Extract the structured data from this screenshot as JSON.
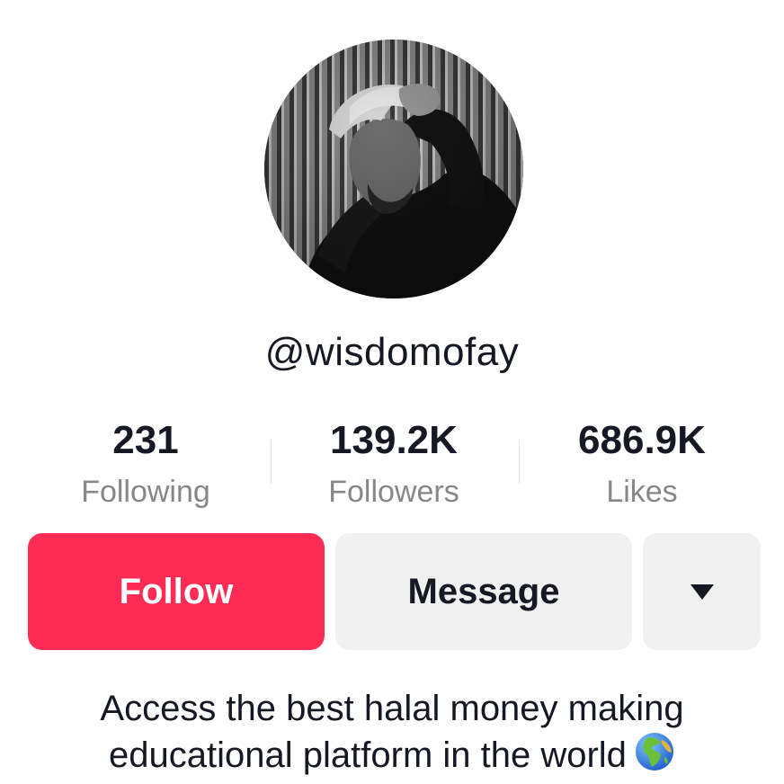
{
  "profile": {
    "username": "@wisdomofay",
    "avatar_alt": "profile photo"
  },
  "stats": [
    {
      "value": "231",
      "label": "Following"
    },
    {
      "value": "139.2K",
      "label": "Followers"
    },
    {
      "value": "686.9K",
      "label": "Likes"
    }
  ],
  "actions": {
    "follow_label": "Follow",
    "message_label": "Message",
    "more_icon": "caret-down-icon"
  },
  "bio": {
    "line1": "Access the best halal money making",
    "line2": "educational platform in the world",
    "emoji_icon": "globe-icon"
  },
  "colors": {
    "follow": "#fe2c55",
    "secondary_button": "#f1f1f2",
    "text": "#161823",
    "muted": "#86878b"
  }
}
